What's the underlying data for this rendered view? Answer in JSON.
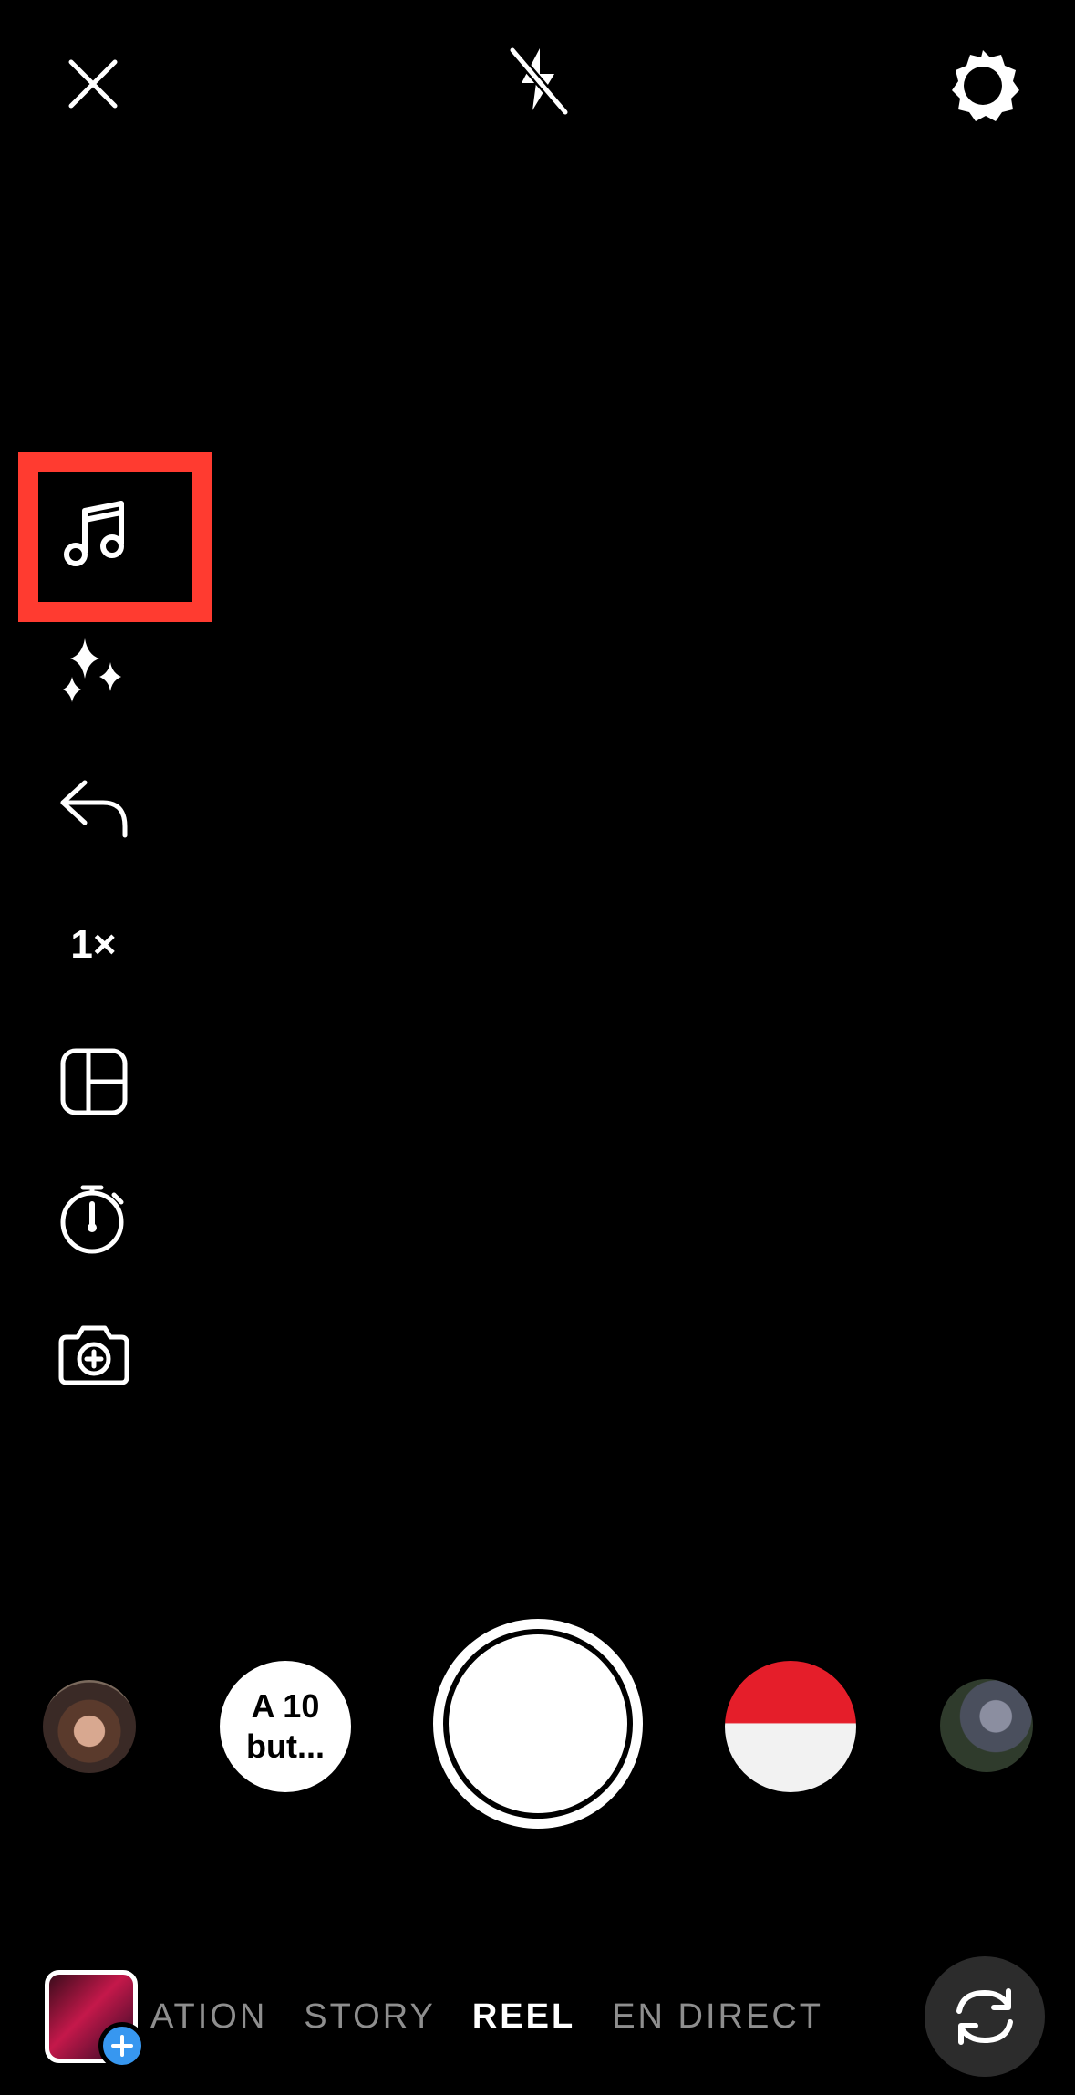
{
  "top_bar": {
    "close_icon": "close-icon",
    "flash_icon": "flash-off-icon",
    "settings_icon": "gear-icon"
  },
  "side_tools": {
    "speed_label": "1×",
    "icons": [
      "music-note-icon",
      "sparkles-icon",
      "reply-arrow-icon",
      "layout-grid-icon",
      "timer-icon",
      "camera-add-icon"
    ]
  },
  "capture_row": {
    "text_bubble_line1": "A 10",
    "text_bubble_line2": "but..."
  },
  "mode_bar": {
    "modes": [
      "ATION",
      "STORY",
      "REEL",
      "EN DIRECT"
    ],
    "active_mode": "REEL"
  },
  "colors": {
    "highlight": "#ff3b30",
    "accent_blue": "#3797f0"
  }
}
